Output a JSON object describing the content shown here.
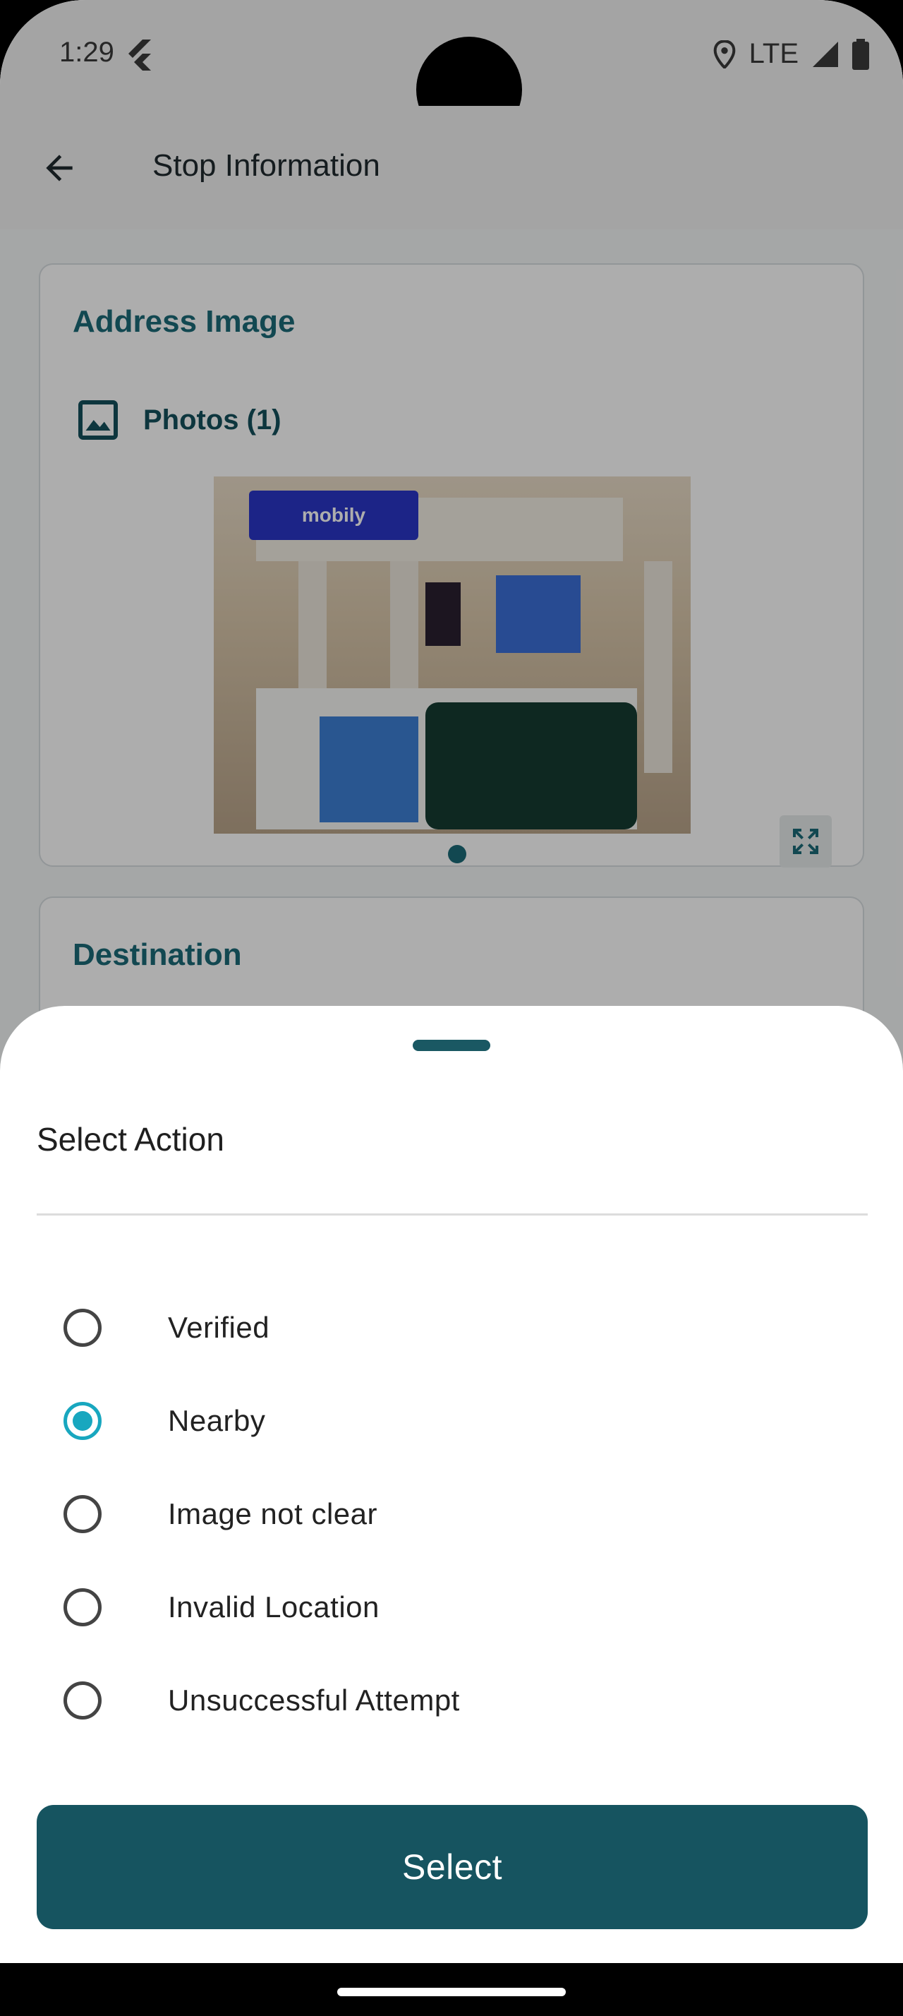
{
  "status_bar": {
    "time": "1:29",
    "network": "LTE",
    "icons": [
      "flutter-icon",
      "location-icon",
      "signal-icon",
      "battery-icon"
    ]
  },
  "app_bar": {
    "title": "Stop Information",
    "back_icon": "arrow-back-icon"
  },
  "address_card": {
    "title": "Address Image",
    "photos_label": "Photos (1)",
    "photo_icon": "image-icon",
    "expand_icon": "fullscreen-icon",
    "sign_text": "mobily"
  },
  "destination_card": {
    "title": "Destination"
  },
  "sheet": {
    "title": "Select Action",
    "options": [
      {
        "label": "Verified",
        "selected": false
      },
      {
        "label": "Nearby",
        "selected": true
      },
      {
        "label": "Image not clear",
        "selected": false
      },
      {
        "label": "Invalid Location",
        "selected": false
      },
      {
        "label": "Unsuccessful Attempt",
        "selected": false
      }
    ],
    "button_label": "Select"
  },
  "colors": {
    "primary": "#165460",
    "accent": "#18a7bf",
    "card_title": "#1b6a78"
  }
}
